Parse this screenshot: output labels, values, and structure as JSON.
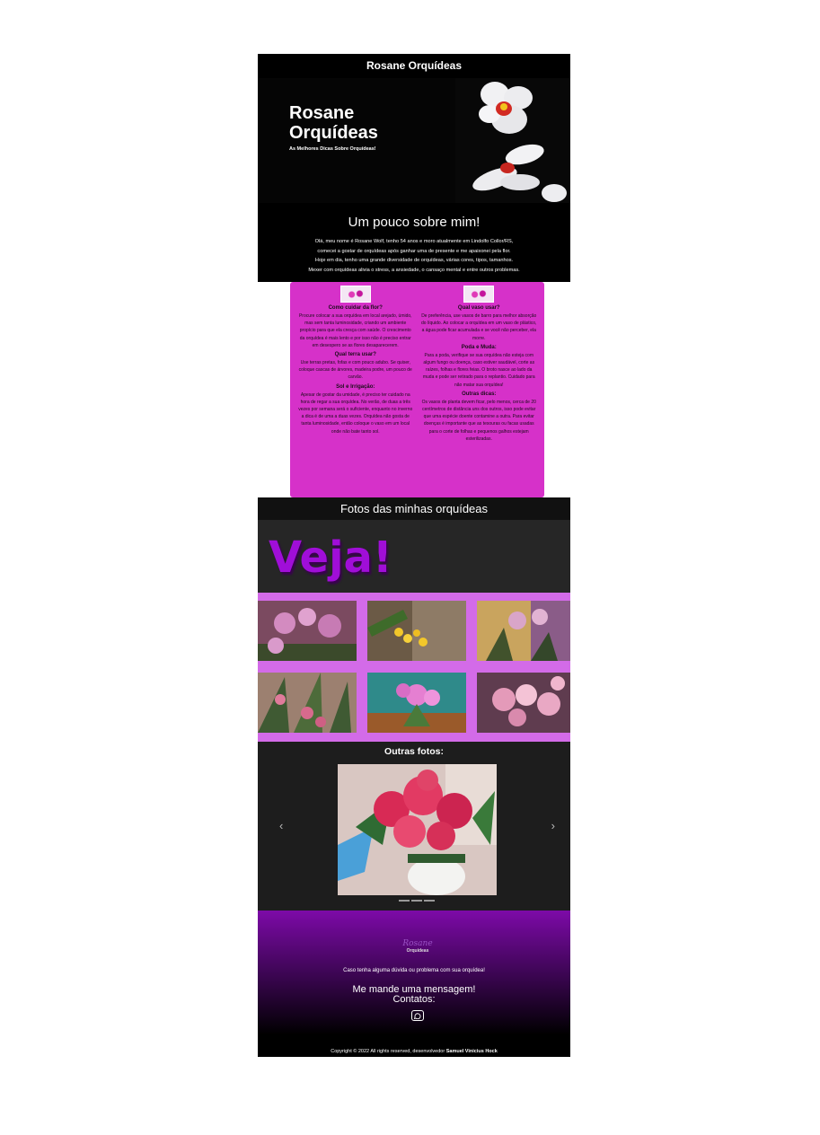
{
  "header": {
    "bar_title": "Rosane Orquídeas",
    "hero_title_line1": "Rosane",
    "hero_title_line2": "Orquídeas",
    "hero_subtitle": "As Melhores Dicas Sobre Orquídeas!"
  },
  "about": {
    "title": "Um pouco sobre mim!",
    "lines": [
      "Olá, meu nome é Rosane Wolf, tenho 54 anos e moro atualmente em Lindolfo Collor/RS,",
      "comecei a gostar de orquídeas após ganhar uma de presente e me apaixonei pela flor.",
      "Hoje em dia, tenho uma grande diversidade de orquídeas, várias cores, tipos, tamanhos.",
      "Mexer com orquídeas alivia o stress, a ansiedade, o cansaço mental e entre outros problemas."
    ]
  },
  "tips": {
    "left": [
      {
        "title": "Como cuidar da flor?",
        "text": "Procure colocar a sua orquídea em local arejado, úmido, mas sem tanta luminosidade, criando um ambiente propício para que ela cresça com saúde. O crescimento da orquídea é mais lento e por isso não é preciso entrar em desespero se as flores desaparecerem."
      },
      {
        "title": "Qual terra usar?",
        "text": "Use terras pretas, fofas e com pouco adubo. Se quiser, coloque cascas de árvores, madeira podre, um pouco de carvão."
      },
      {
        "title": "Sol e Irrigação:",
        "text": "Apesar de gostar da umidade, é preciso ter cuidado na hora de regar a sua orquídea. No verão, de duas a três vezes por semana será o suficiente, enquanto no inverno a dica é de uma a duas vezes. Orquídea não gosta de tanta luminosidade, então coloque o vaso em um local onde não bate tanto sol."
      }
    ],
    "right": [
      {
        "title": "Qual vaso usar?",
        "text": "De preferência, use vasos de barro para melhor absorção do líquido. Ao colocar a orquídea em um vaso de plástico, a água pode ficar acumulada e se você não perceber, ela morre."
      },
      {
        "title": "Poda e Muda:",
        "text": "Para a poda, verifique se sua orquídea não esteja com algum fungo ou doença, caso estiver saudável, corte as raízes, folhas e flores feias. O broto nasce ao lado da muda e pode ser retirado para o replantio. Cuidado para não matar sua orquídea!"
      },
      {
        "title": "Outras dicas:",
        "text": "Os vasos de planta devem ficar, pelo menos, cerca de 20 centímetros de distância uns dos outros, isso pode evitar que uma espécie doente contamine a outra. Para evitar doenças é importante que as tesouras ou facas usadas para o corte de folhas e pequenos galhos estejam esterilizadas."
      }
    ]
  },
  "photos": {
    "title": "Fotos das minhas orquídeas",
    "banner": "Veja!",
    "grid": [
      {
        "name": "pink-orchids-photo",
        "colors": [
          "#8a4f6a",
          "#d38bc0",
          "#3b4a2b"
        ]
      },
      {
        "name": "yellow-orchids-photo",
        "colors": [
          "#6b5a46",
          "#f2c72a",
          "#8e7b66"
        ]
      },
      {
        "name": "pink-orchids-window-photo",
        "colors": [
          "#c9a45e",
          "#d9a5c9",
          "#41522c"
        ]
      },
      {
        "name": "pink-orchid-stems-photo",
        "colors": [
          "#3f5a33",
          "#d86a8d",
          "#9c8070"
        ]
      },
      {
        "name": "pink-orchid-pot-photo",
        "colors": [
          "#2f8a8a",
          "#e57fd1",
          "#9a5a2a"
        ]
      },
      {
        "name": "light-pink-orchids-photo",
        "colors": [
          "#5f3c4f",
          "#e49ab9",
          "#f4c3d6"
        ]
      }
    ]
  },
  "carousel": {
    "title": "Outras fotos:",
    "prev": "‹",
    "next": "›"
  },
  "footer": {
    "logo_line1": "Rosane",
    "logo_line2": "Orquídeas",
    "question": "Caso tenha alguma dúvida ou problema com sua orquídea!",
    "message": "Me mande uma mensagem!",
    "contacts": "Contatos:",
    "copyright": "Copyright © 2022 All rights reserved, desenvolvedor",
    "developer": "Samuel Vinicius Hock"
  }
}
